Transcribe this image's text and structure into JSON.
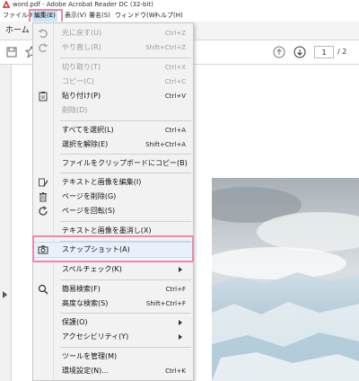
{
  "window": {
    "title": "word.pdf - Adobe Acrobat Reader DC (32-bit)"
  },
  "menubar": [
    {
      "id": "file",
      "label": "ファイル(F)"
    },
    {
      "id": "edit",
      "label": "編集(E)"
    },
    {
      "id": "view",
      "label": "表示(V)"
    },
    {
      "id": "sign",
      "label": "署名(S)"
    },
    {
      "id": "window",
      "label": "ウィンドウ(W)"
    },
    {
      "id": "help",
      "label": "ヘルプ(H)"
    }
  ],
  "tabs": {
    "home": "ホーム"
  },
  "toolbar": {
    "page_current": "1",
    "page_total": "/ 2"
  },
  "edit_menu": {
    "items": [
      {
        "label": "元に戻す(U)",
        "shortcut": "Ctrl+Z",
        "icon": "undo-icon",
        "disabled": true
      },
      {
        "label": "やり直し(R)",
        "shortcut": "Shift+Ctrl+Z",
        "icon": "redo-icon",
        "disabled": true
      },
      {
        "label": "切り取り(T)",
        "shortcut": "Ctrl+X",
        "icon": "",
        "disabled": true
      },
      {
        "label": "コピー(C)",
        "shortcut": "Ctrl+C",
        "icon": "",
        "disabled": true
      },
      {
        "label": "貼り付け(P)",
        "shortcut": "Ctrl+V",
        "icon": "clipboard-icon",
        "disabled": false
      },
      {
        "label": "削除(D)",
        "shortcut": "",
        "icon": "",
        "disabled": true
      },
      {
        "label": "すべてを選択(L)",
        "shortcut": "Ctrl+A",
        "icon": "",
        "disabled": false
      },
      {
        "label": "選択を解除(E)",
        "shortcut": "Shift+Ctrl+A",
        "icon": "",
        "disabled": false
      },
      {
        "label": "ファイルをクリップボードにコピー(B)",
        "shortcut": "",
        "icon": "",
        "disabled": false
      },
      {
        "label": "テキストと画像を編集(I)",
        "shortcut": "",
        "icon": "edit-text-icon",
        "disabled": false
      },
      {
        "label": "ページを削除(G)",
        "shortcut": "",
        "icon": "trash-icon",
        "disabled": false
      },
      {
        "label": "ページを回転(S)",
        "shortcut": "",
        "icon": "rotate-icon",
        "disabled": false
      },
      {
        "label": "テキストと画像を墨消し(X)",
        "shortcut": "",
        "icon": "",
        "disabled": false
      },
      {
        "label": "スナップショット(A)",
        "shortcut": "",
        "icon": "camera-icon",
        "disabled": false,
        "highlighted": true
      },
      {
        "label": "スペルチェック(K)",
        "shortcut": "",
        "icon": "",
        "disabled": false,
        "submenu": true
      },
      {
        "label": "簡易検索(F)",
        "shortcut": "Ctrl+F",
        "icon": "search-icon",
        "disabled": false
      },
      {
        "label": "高度な検索(S)",
        "shortcut": "Shift+Ctrl+F",
        "icon": "",
        "disabled": false
      },
      {
        "label": "保護(O)",
        "shortcut": "",
        "icon": "",
        "disabled": false,
        "submenu": true
      },
      {
        "label": "アクセシビリティ(Y)",
        "shortcut": "",
        "icon": "",
        "disabled": false,
        "submenu": true
      },
      {
        "label": "ツールを管理(M)",
        "shortcut": "",
        "icon": "",
        "disabled": false
      },
      {
        "label": "環境設定(N)...",
        "shortcut": "Ctrl+K",
        "icon": "",
        "disabled": false
      }
    ]
  },
  "colors": {
    "highlight_box": "#e98aa8",
    "menu_bg": "#f2f2f2",
    "acrobat_red": "#d9221c"
  }
}
